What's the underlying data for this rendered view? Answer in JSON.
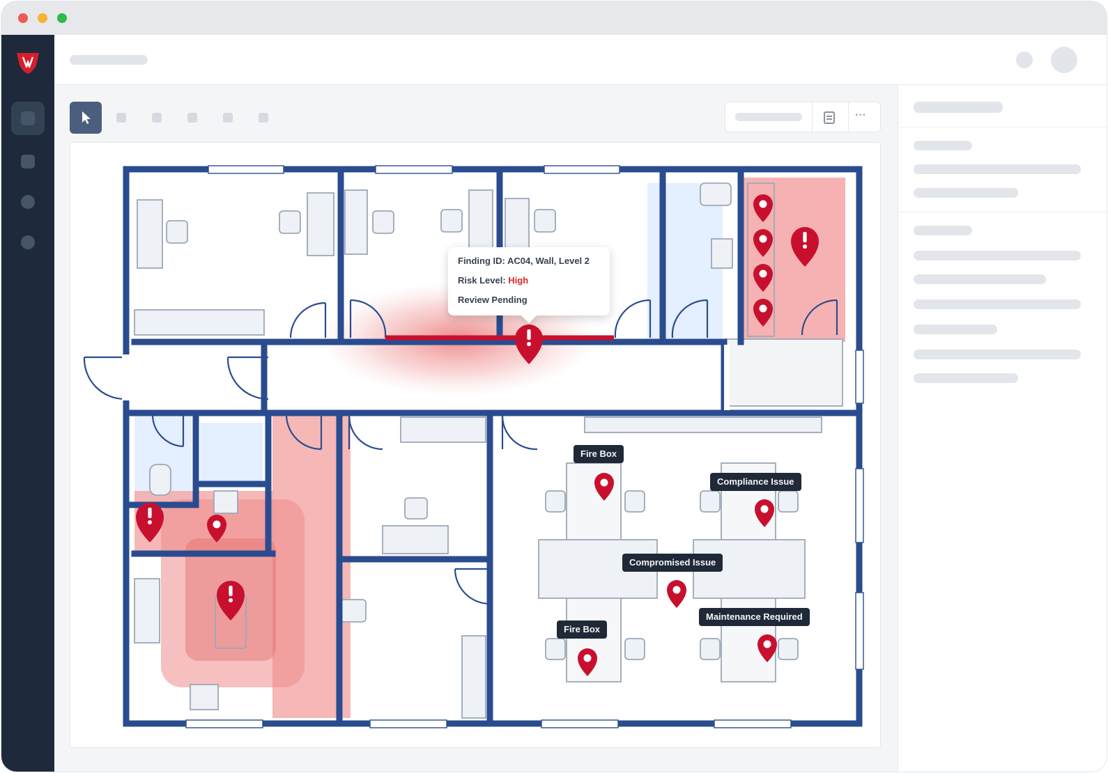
{
  "window": {
    "controls": [
      "close",
      "minimize",
      "maximize"
    ],
    "colors": {
      "close": "#ee5b52",
      "minimize": "#f5b431",
      "maximize": "#2fb94c"
    }
  },
  "sidebar": {
    "logo_icon": "shield-logo-icon",
    "items": [
      "nav-item-1",
      "nav-item-2",
      "nav-item-3",
      "nav-item-4"
    ]
  },
  "toolbar": {
    "tools": [
      "select-tool",
      "tool-2",
      "tool-3",
      "tool-4",
      "tool-5",
      "tool-6"
    ],
    "right_controls": [
      "view-dropdown",
      "layers-icon",
      "more-icon"
    ],
    "more_label": "···"
  },
  "floorplan": {
    "wall_color": "#2a4c8f",
    "pin_color": "#c8102e",
    "popup": {
      "line1": "Finding ID: AC04, Wall, Level 2",
      "line2_prefix": "Risk Level: ",
      "line2_value": "High",
      "line3": "Review Pending"
    },
    "labels": [
      "Fire Box",
      "Compliance Issue",
      "Compromised Issue",
      "Fire Box",
      "Maintenance Required"
    ]
  }
}
